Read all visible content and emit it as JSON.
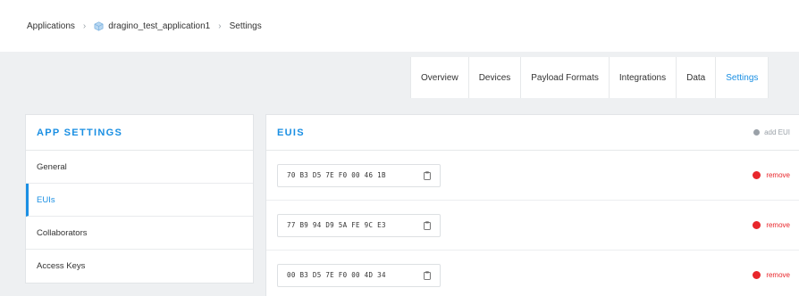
{
  "breadcrumb": {
    "root": "Applications",
    "application": "dragino_test_application1",
    "current": "Settings"
  },
  "tabs": [
    {
      "label": "Overview"
    },
    {
      "label": "Devices"
    },
    {
      "label": "Payload Formats"
    },
    {
      "label": "Integrations"
    },
    {
      "label": "Data"
    },
    {
      "label": "Settings",
      "active": true
    }
  ],
  "sidebar": {
    "title": "APP SETTINGS",
    "items": [
      {
        "label": "General"
      },
      {
        "label": "EUIs",
        "active": true
      },
      {
        "label": "Collaborators"
      },
      {
        "label": "Access Keys"
      }
    ]
  },
  "euis": {
    "title": "EUIS",
    "add_label": "add EUI",
    "remove_label": "remove",
    "rows": [
      {
        "value": "70 B3 D5 7E F0 00 46 1B"
      },
      {
        "value": "77 B9 94 D9 5A FE 9C E3"
      },
      {
        "value": "00 B3 D5 7E F0 00 4D 34"
      }
    ]
  },
  "colors": {
    "accent": "#1a8fe3",
    "danger": "#e8262b",
    "muted": "#9aa1a8"
  },
  "icons": {
    "separator": "chevron-right-icon",
    "application": "cube-icon",
    "copy": "clipboard-icon",
    "add": "plus-circle-icon",
    "remove": "minus-circle-icon"
  }
}
